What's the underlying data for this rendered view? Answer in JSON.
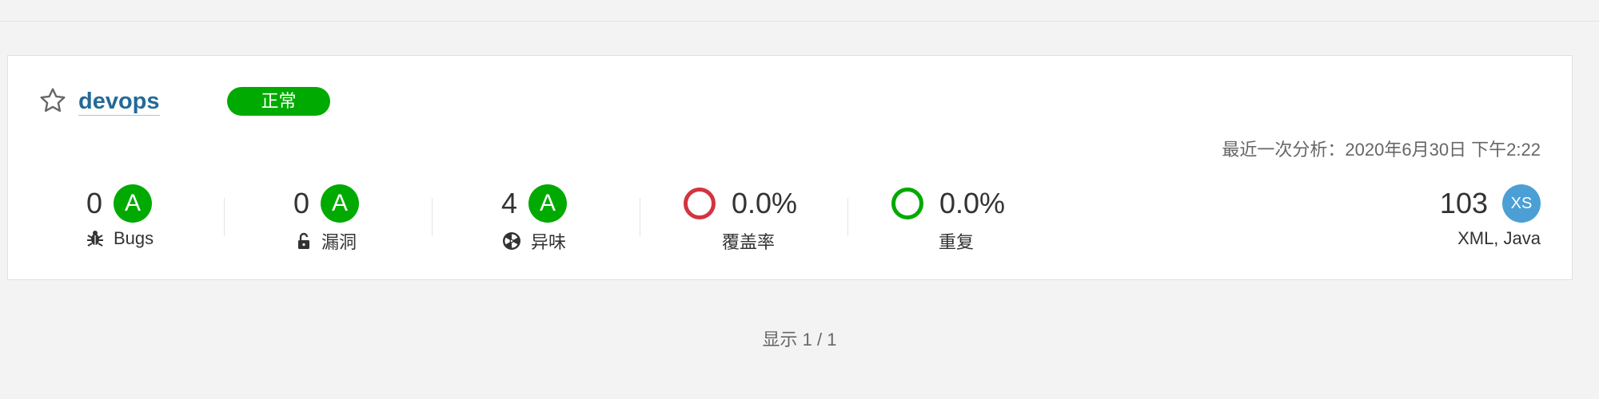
{
  "project": {
    "name": "devops",
    "quality_gate": "正常",
    "last_analysis_label": "最近一次分析：",
    "last_analysis_value": "2020年6月30日 下午2:22"
  },
  "metrics": {
    "bugs": {
      "value": "0",
      "rating": "A",
      "label": "Bugs",
      "icon": "bug-icon"
    },
    "vulnerabilities": {
      "value": "0",
      "rating": "A",
      "label": "漏洞",
      "icon": "unlock-icon"
    },
    "code_smells": {
      "value": "4",
      "rating": "A",
      "label": "异味",
      "icon": "radiation-icon"
    },
    "coverage": {
      "value": "0.0%",
      "label": "覆盖率",
      "ring_color": "#d4333f"
    },
    "duplications": {
      "value": "0.0%",
      "label": "重复",
      "ring_color": "#00aa00"
    },
    "size": {
      "value": "103",
      "badge": "XS",
      "languages": "XML, Java",
      "badge_color": "#4b9fd5"
    }
  },
  "pager": {
    "text": "显示 1 / 1"
  },
  "colors": {
    "accent_link": "#236a97",
    "rating_a": "#00aa00",
    "status_ok": "#00aa00"
  }
}
